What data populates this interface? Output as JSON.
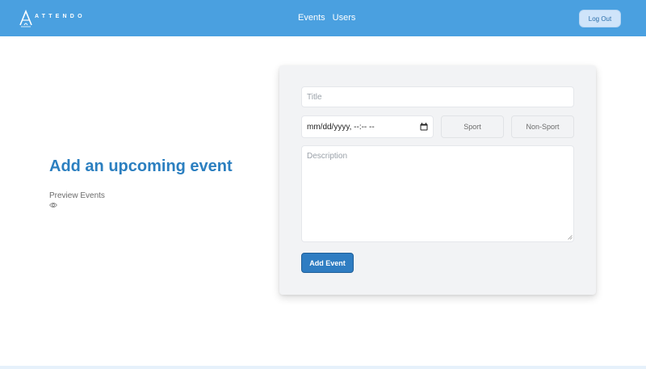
{
  "header": {
    "brand": "ATTENDO",
    "nav": [
      {
        "label": "Events"
      },
      {
        "label": "Users"
      }
    ],
    "logout_label": "Log Out"
  },
  "main": {
    "heading": "Add an upcoming event",
    "preview_label": "Preview Events",
    "preview_icon": "eye-icon"
  },
  "form": {
    "title_placeholder": "Title",
    "date_value": "mm/dd/yyyy, --:-- --",
    "sport_label": "Sport",
    "nonsport_label": "Non-Sport",
    "description_placeholder": "Description",
    "submit_label": "Add Event"
  },
  "colors": {
    "header_bg": "#4aa0e0",
    "accent": "#2f7dc2",
    "heading": "#2b7fc0",
    "card_bg": "#f2f3f5"
  }
}
